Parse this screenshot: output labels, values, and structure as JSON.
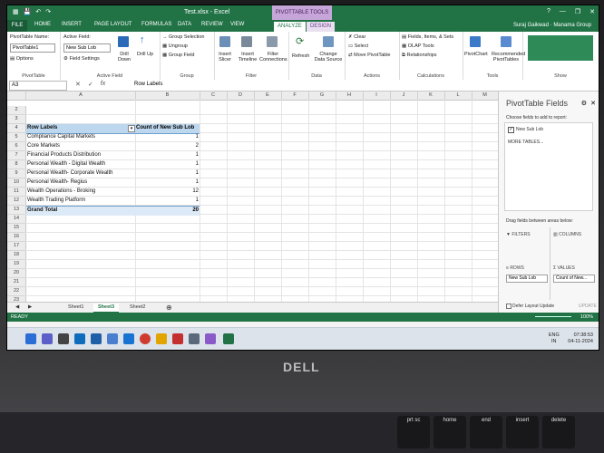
{
  "window": {
    "title": "Test.xlsx - Excel",
    "context_group": "PIVOTTABLE TOOLS",
    "user": "Suraj Gaikwad",
    "org": "Manama Group"
  },
  "tabs": [
    "FILE",
    "HOME",
    "INSERT",
    "PAGE LAYOUT",
    "FORMULAS",
    "DATA",
    "REVIEW",
    "VIEW",
    "ANALYZE",
    "DESIGN"
  ],
  "active_tab": "ANALYZE",
  "ribbon": {
    "pivottable": {
      "name_label": "PivotTable Name:",
      "name_value": "PivotTable1",
      "options": "Options",
      "group": "PivotTable"
    },
    "active_field": {
      "label": "Active Field:",
      "value": "New Sub Lob",
      "settings": "Field Settings",
      "drill_down": "Drill Down",
      "drill_up": "Drill Up",
      "group": "Active Field"
    },
    "group": {
      "selection": "Group Selection",
      "ungroup": "Ungroup",
      "field": "Group Field",
      "group": "Group"
    },
    "filter": {
      "slicer": "Insert Slicer",
      "timeline": "Insert Timeline",
      "connections": "Filter Connections",
      "group": "Filter"
    },
    "data": {
      "refresh": "Refresh",
      "change_source": "Change Data Source",
      "group": "Data"
    },
    "actions": {
      "clear": "Clear",
      "select": "Select",
      "move": "Move PivotTable",
      "group": "Actions"
    },
    "calculations": {
      "fields": "Fields, Items, & Sets",
      "olap": "OLAP Tools",
      "relationships": "Relationships",
      "group": "Calculations"
    },
    "tools": {
      "pivotchart": "PivotChart",
      "recommended": "Recommended PivotTables",
      "group": "Tools"
    },
    "show": {
      "group": "Show"
    }
  },
  "formula_bar": {
    "cell_ref": "A3",
    "value": "Row Labels"
  },
  "columns": [
    "A",
    "B",
    "C",
    "D",
    "E",
    "F",
    "G",
    "H",
    "I",
    "J",
    "K",
    "L",
    "M"
  ],
  "pivot": {
    "header": {
      "label": "Row Labels",
      "value": "Count of New Sub Lob"
    },
    "rows": [
      {
        "label": "Compliance Capital Markets",
        "value": "1"
      },
      {
        "label": "Core Markets",
        "value": "2"
      },
      {
        "label": "Financial Products Distribution",
        "value": "1"
      },
      {
        "label": "Personal Wealth - Digital Wealth",
        "value": "1"
      },
      {
        "label": "Personal Wealth- Corporate Wealth",
        "value": "1"
      },
      {
        "label": "Personal Wealth- Regius",
        "value": "1"
      },
      {
        "label": "Wealth Operations - Broking",
        "value": "12"
      },
      {
        "label": "Wealth Trading Platform",
        "value": "1"
      }
    ],
    "total": {
      "label": "Grand Total",
      "value": "20"
    }
  },
  "row_numbers": [
    "2",
    "3",
    "4",
    "5",
    "6",
    "7",
    "8",
    "9",
    "10",
    "11",
    "12",
    "13",
    "14",
    "15",
    "16",
    "17",
    "18",
    "19",
    "20",
    "21",
    "22",
    "23"
  ],
  "sheets": [
    "Sheet1",
    "Sheet3",
    "Sheet2"
  ],
  "active_sheet": "Sheet3",
  "status": {
    "left": "READY",
    "zoom": "100%"
  },
  "fields_panel": {
    "title": "PivotTable Fields",
    "subtitle": "Choose fields to add to report:",
    "field": "New Sub Lob",
    "more": "MORE TABLES...",
    "drag_text": "Drag fields between areas below:",
    "filters": "FILTERS",
    "columns": "COLUMNS",
    "rows": "ROWS",
    "values": "VALUES",
    "rows_chip": "New Sub Lob",
    "values_chip": "Count of New...",
    "defer": "Defer Layout Update",
    "update": "UPDATE"
  },
  "taskbar": {
    "lang": "ENG",
    "region": "IN",
    "time": "07:38:53",
    "date": "04-11-2024"
  },
  "laptop": {
    "brand": "DELL"
  },
  "keyboard": [
    "prt sc",
    "home",
    "end",
    "insert",
    "delete"
  ]
}
